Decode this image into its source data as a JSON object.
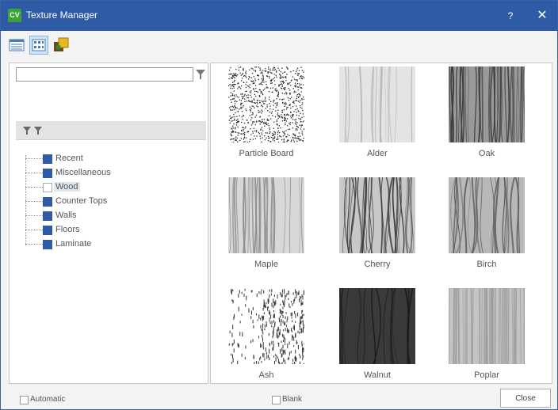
{
  "window": {
    "logo": "CV",
    "title": "Texture Manager",
    "help_label": "?",
    "close_label": "✕",
    "accent_color": "#2e5aa6"
  },
  "toolbar": {
    "buttons": [
      {
        "icon": "list-view-icon",
        "active": false
      },
      {
        "icon": "grid-view-icon",
        "active": true
      },
      {
        "icon": "texture-editor-icon",
        "active": false
      }
    ]
  },
  "search": {
    "value": "",
    "placeholder": ""
  },
  "tree": {
    "items": [
      {
        "label": "Recent",
        "selected": false
      },
      {
        "label": "Miscellaneous",
        "selected": false
      },
      {
        "label": "Wood",
        "selected": true
      },
      {
        "label": "Counter Tops",
        "selected": false
      },
      {
        "label": "Walls",
        "selected": false
      },
      {
        "label": "Floors",
        "selected": false
      },
      {
        "label": "Laminate",
        "selected": false
      }
    ]
  },
  "textures": [
    {
      "name": "Particle Board",
      "style": "particle"
    },
    {
      "name": "Alder",
      "style": "alder"
    },
    {
      "name": "Oak",
      "style": "oak"
    },
    {
      "name": "Maple",
      "style": "maple"
    },
    {
      "name": "Cherry",
      "style": "cherry"
    },
    {
      "name": "Birch",
      "style": "birch"
    },
    {
      "name": "Ash",
      "style": "ash"
    },
    {
      "name": "Walnut",
      "style": "walnut"
    },
    {
      "name": "Poplar",
      "style": "poplar"
    }
  ],
  "footer": {
    "automatic_label": "Automatic",
    "automatic_checked": false,
    "blank_label": "Blank",
    "blank_checked": false,
    "close_label": "Close"
  }
}
